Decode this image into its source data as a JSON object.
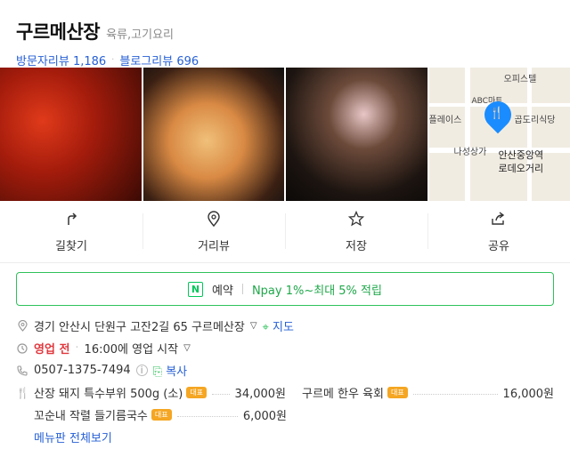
{
  "place": {
    "name": "구르메산장",
    "category": "육류,고기요리",
    "visitor_reviews_label": "방문자리뷰",
    "visitor_reviews_count": "1,186",
    "blog_reviews_label": "블로그리뷰",
    "blog_reviews_count": "696"
  },
  "map": {
    "labels": [
      "오피스텔",
      "ABC마트",
      "플레이스",
      "곱도리식당",
      "나성상가",
      "안산중앙역",
      "로데오거리"
    ]
  },
  "actions": [
    {
      "label": "길찾기",
      "icon": "directions-icon"
    },
    {
      "label": "거리뷰",
      "icon": "location-pin-icon"
    },
    {
      "label": "저장",
      "icon": "star-icon"
    },
    {
      "label": "공유",
      "icon": "share-icon"
    }
  ],
  "booking": {
    "badge": "N",
    "label": "예약",
    "npay": "Npay 1%~최대 5% 적립"
  },
  "info": {
    "address": "경기 안산시 단원구 고잔2길 65 구르메산장",
    "map_link": "지도",
    "status": "영업 전",
    "hours": "16:00에 영업 시작",
    "phone": "0507-1375-7494",
    "copy": "복사"
  },
  "menu": {
    "badge": "대표",
    "items": [
      {
        "name": "산장 돼지 특수부위 500g (소)",
        "price": "34,000원"
      },
      {
        "name": "구르메 한우 육회",
        "price": "16,000원"
      },
      {
        "name": "꼬순내 작렬 들기름국수",
        "price": "6,000원"
      }
    ],
    "more": "메뉴판 전체보기"
  },
  "colors": {
    "accent": "#2660d6",
    "naver_green": "#03c75a",
    "status_red": "#e0383e",
    "badge": "#f5a623"
  }
}
